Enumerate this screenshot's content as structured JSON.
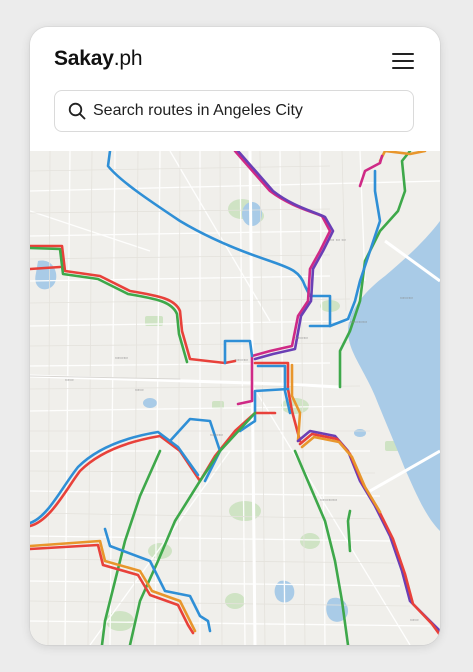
{
  "app": {
    "brand": "Sakay",
    "tld": ".ph"
  },
  "header": {
    "menu_icon": "hamburger-menu-icon"
  },
  "search": {
    "icon": "search-icon",
    "placeholder": "Search routes in Angeles City"
  },
  "map": {
    "water_color": "#a9cbe7",
    "park_color": "#cfe3c4",
    "route_colors": {
      "red": "#e8413a",
      "green": "#3ea84a",
      "blue": "#2f8fd6",
      "purple": "#6a3fb5",
      "magenta": "#cf2a86",
      "orange": "#e8962c"
    }
  }
}
